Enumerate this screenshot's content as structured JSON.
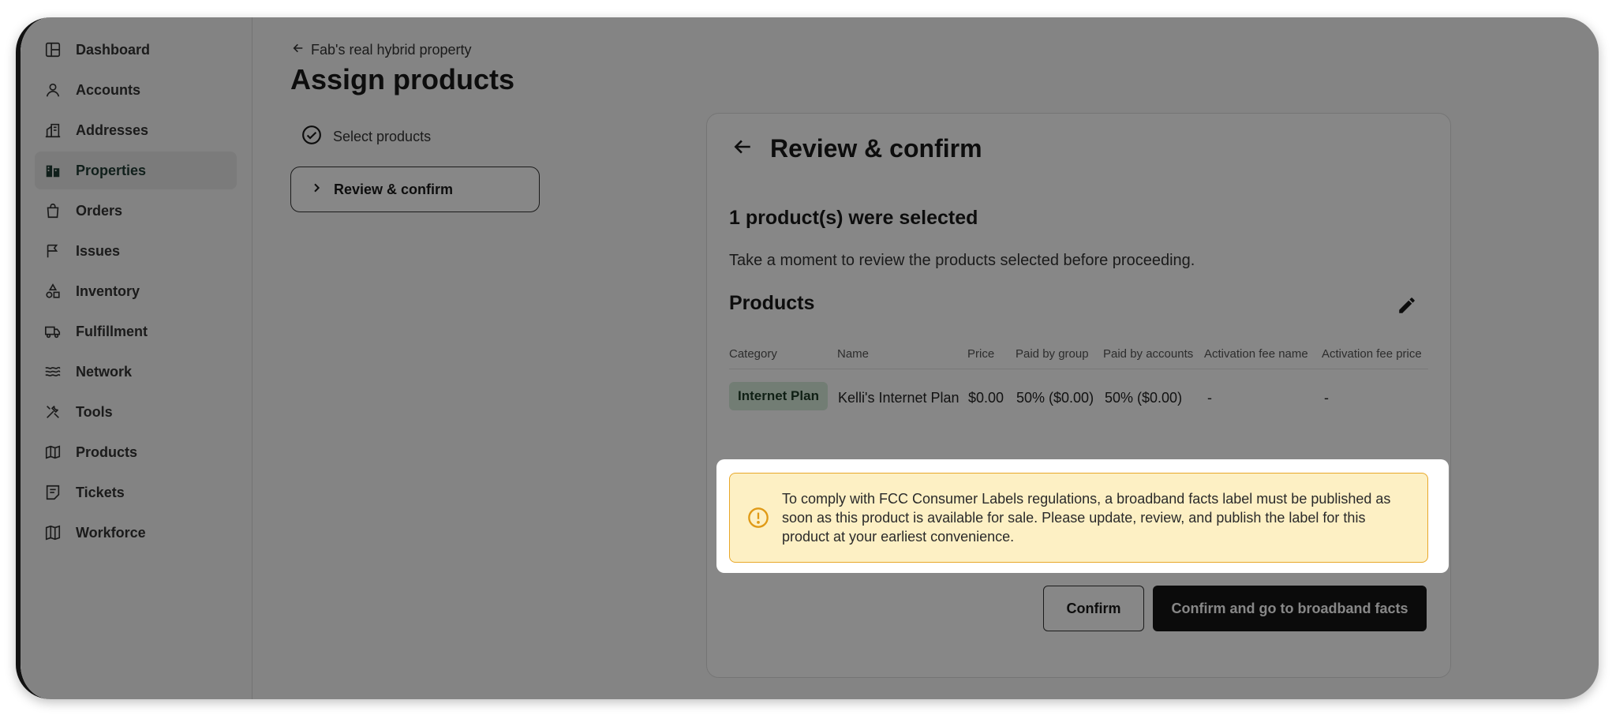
{
  "sidebar": {
    "items": [
      {
        "label": "Dashboard",
        "icon": "dashboard-icon"
      },
      {
        "label": "Accounts",
        "icon": "user-icon"
      },
      {
        "label": "Addresses",
        "icon": "buildings-icon"
      },
      {
        "label": "Properties",
        "icon": "building-icon",
        "active": true
      },
      {
        "label": "Orders",
        "icon": "bag-icon"
      },
      {
        "label": "Issues",
        "icon": "flag-icon"
      },
      {
        "label": "Inventory",
        "icon": "shapes-icon"
      },
      {
        "label": "Fulfillment",
        "icon": "truck-icon"
      },
      {
        "label": "Network",
        "icon": "waves-icon"
      },
      {
        "label": "Tools",
        "icon": "tools-icon"
      },
      {
        "label": "Products",
        "icon": "map-book-icon"
      },
      {
        "label": "Tickets",
        "icon": "ticket-icon"
      },
      {
        "label": "Workforce",
        "icon": "map-icon"
      }
    ]
  },
  "header": {
    "back_label": "Fab's real hybrid property",
    "title": "Assign products"
  },
  "steps": {
    "select": "Select products",
    "review": "Review & confirm"
  },
  "panel": {
    "title": "Review & confirm",
    "selected_count": "1 product(s) were selected",
    "note": "Take a moment to review the products selected before proceeding.",
    "products_heading": "Products"
  },
  "table": {
    "headers": {
      "category": "Category",
      "name": "Name",
      "price": "Price",
      "paid_group": "Paid by group",
      "paid_accounts": "Paid by accounts",
      "fee_name": "Activation fee name",
      "fee_price": "Activation fee price"
    },
    "rows": [
      {
        "category": "Internet Plan",
        "name": "Kelli's Internet Plan",
        "price": "$0.00",
        "paid_group": "50% ($0.00)",
        "paid_accounts": "50% ($0.00)",
        "fee_name": "-",
        "fee_price": "-"
      }
    ]
  },
  "alert": {
    "text": "To comply with FCC Consumer Labels regulations, a broadband facts label must be published as soon as this product is available for sale. Please update, review, and publish the label for this product at your earliest convenience.",
    "border_color": "#e8a82a",
    "background": "#fdf0c4"
  },
  "actions": {
    "confirm": "Confirm",
    "confirm_facts": "Confirm and go to broadband facts"
  }
}
